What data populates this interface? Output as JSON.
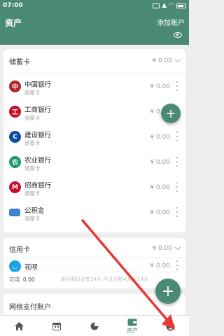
{
  "status_bar": {
    "time": "07:00"
  },
  "header": {
    "title": "资产",
    "add_account": "添加账户"
  },
  "debit": {
    "title": "储蓄卡",
    "amount": "¥ 0.00",
    "accounts": [
      {
        "name": "中国银行",
        "type": "储蓄卡",
        "amount": "¥ 0.00",
        "icon": "boc-icon",
        "color": "#b0262c"
      },
      {
        "name": "工商银行",
        "type": "储蓄卡",
        "amount": "¥ 0.00",
        "icon": "icbc-icon",
        "color": "#c8102e"
      },
      {
        "name": "建设银行",
        "type": "储蓄卡",
        "amount": "¥ 0.00",
        "icon": "ccb-icon",
        "color": "#0a4ea2"
      },
      {
        "name": "农业银行",
        "type": "储蓄卡",
        "amount": "¥ 0.00",
        "icon": "abc-icon",
        "color": "#1a9a6b"
      },
      {
        "name": "招商银行",
        "type": "储蓄卡",
        "amount": "¥ 0.00",
        "icon": "cmb-icon",
        "color": "#c8102e"
      },
      {
        "name": "公积金",
        "type": "储蓄卡",
        "amount": "¥ 0.00",
        "icon": "fund-card-icon",
        "color": "#3f7fd0"
      }
    ]
  },
  "credit": {
    "title": "信用卡",
    "amount": "¥ 0.00",
    "account": {
      "name": "花呗",
      "amount": "¥ 0.00",
      "icon": "huabei-icon",
      "color": "#1ea0e6"
    },
    "available_label": "可用:",
    "available_value": "0.00",
    "note": "距还款日还有14天,今日还款可免息14天"
  },
  "net": {
    "title": "网络支付账户"
  },
  "tabs": [
    {
      "label": "",
      "icon": "home-icon"
    },
    {
      "label": "",
      "icon": "calendar-icon"
    },
    {
      "label": "",
      "icon": "pie-chart-icon"
    },
    {
      "label": "资产",
      "icon": "wallet-icon"
    },
    {
      "label": "",
      "icon": "profile-icon"
    }
  ],
  "colors": {
    "primary": "#4a8a72",
    "arrow": "#e53935"
  }
}
